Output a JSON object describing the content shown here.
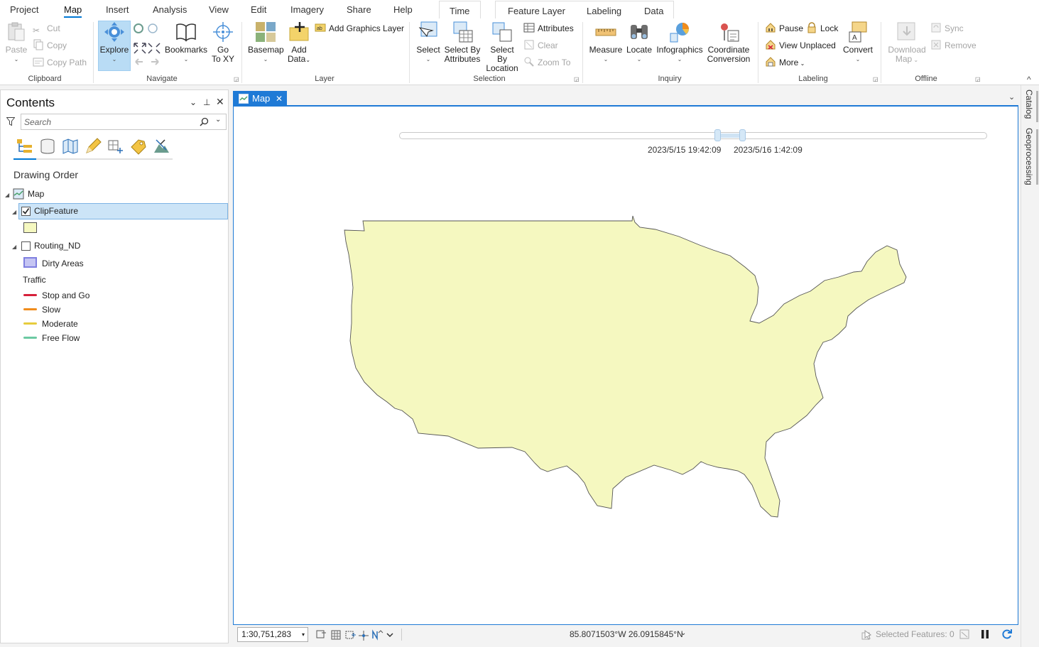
{
  "ribbon_tabs": {
    "project": "Project",
    "map": "Map",
    "insert": "Insert",
    "analysis": "Analysis",
    "view": "View",
    "edit": "Edit",
    "imagery": "Imagery",
    "share": "Share",
    "help": "Help",
    "time": "Time",
    "feature_layer": "Feature Layer",
    "labeling": "Labeling",
    "data": "Data"
  },
  "clipboard": {
    "paste": "Paste",
    "cut": "Cut",
    "copy": "Copy",
    "copy_path": "Copy Path",
    "label": "Clipboard"
  },
  "navigate": {
    "explore": "Explore",
    "bookmarks": "Bookmarks",
    "go_to_xy_1": "Go",
    "go_to_xy_2": "To XY",
    "label": "Navigate"
  },
  "layer": {
    "basemap": "Basemap",
    "add_data_1": "Add",
    "add_data_2": "Data",
    "add_graphics_layer": "Add Graphics Layer",
    "label": "Layer"
  },
  "selection": {
    "select": "Select",
    "select_by_attr_1": "Select By",
    "select_by_attr_2": "Attributes",
    "select_by_loc_1": "Select By",
    "select_by_loc_2": "Location",
    "attributes": "Attributes",
    "clear": "Clear",
    "zoom_to": "Zoom To",
    "label": "Selection"
  },
  "inquiry": {
    "measure": "Measure",
    "locate": "Locate",
    "infographics": "Infographics",
    "coord_conv_1": "Coordinate",
    "coord_conv_2": "Conversion",
    "label": "Inquiry"
  },
  "labeling_group": {
    "pause": "Pause",
    "lock": "Lock",
    "view_unplaced": "View Unplaced",
    "more": "More",
    "convert": "Convert",
    "label": "Labeling"
  },
  "offline": {
    "download_map_1": "Download",
    "download_map_2": "Map",
    "sync": "Sync",
    "remove": "Remove",
    "label": "Offline"
  },
  "contents": {
    "title": "Contents",
    "search_placeholder": "Search",
    "drawing_order": "Drawing Order",
    "map_node": "Map",
    "layers": [
      {
        "name": "ClipFeature",
        "checked": true,
        "symbol_color": "#f5f8c0"
      },
      {
        "name": "Routing_ND",
        "checked": false
      }
    ],
    "dirty_areas": "Dirty Areas",
    "traffic_heading": "Traffic",
    "traffic_legend": [
      {
        "label": "Stop and Go",
        "color": "#d6203a"
      },
      {
        "label": "Slow",
        "color": "#f08c1c"
      },
      {
        "label": "Moderate",
        "color": "#e6cc3d"
      },
      {
        "label": "Free Flow",
        "color": "#6cc9a2"
      }
    ]
  },
  "map_view": {
    "tab_label": "Map",
    "time_start": "2023/5/15 19:42:09",
    "time_end": "2023/5/16 1:42:09",
    "feature_fill": "#f5f8c0"
  },
  "status": {
    "scale": "1:30,751,283",
    "coordinates": "85.8071503°W 26.0915845°N",
    "selected_features": "Selected Features: 0"
  },
  "dock": {
    "catalog": "Catalog",
    "geoprocessing": "Geoprocessing"
  }
}
